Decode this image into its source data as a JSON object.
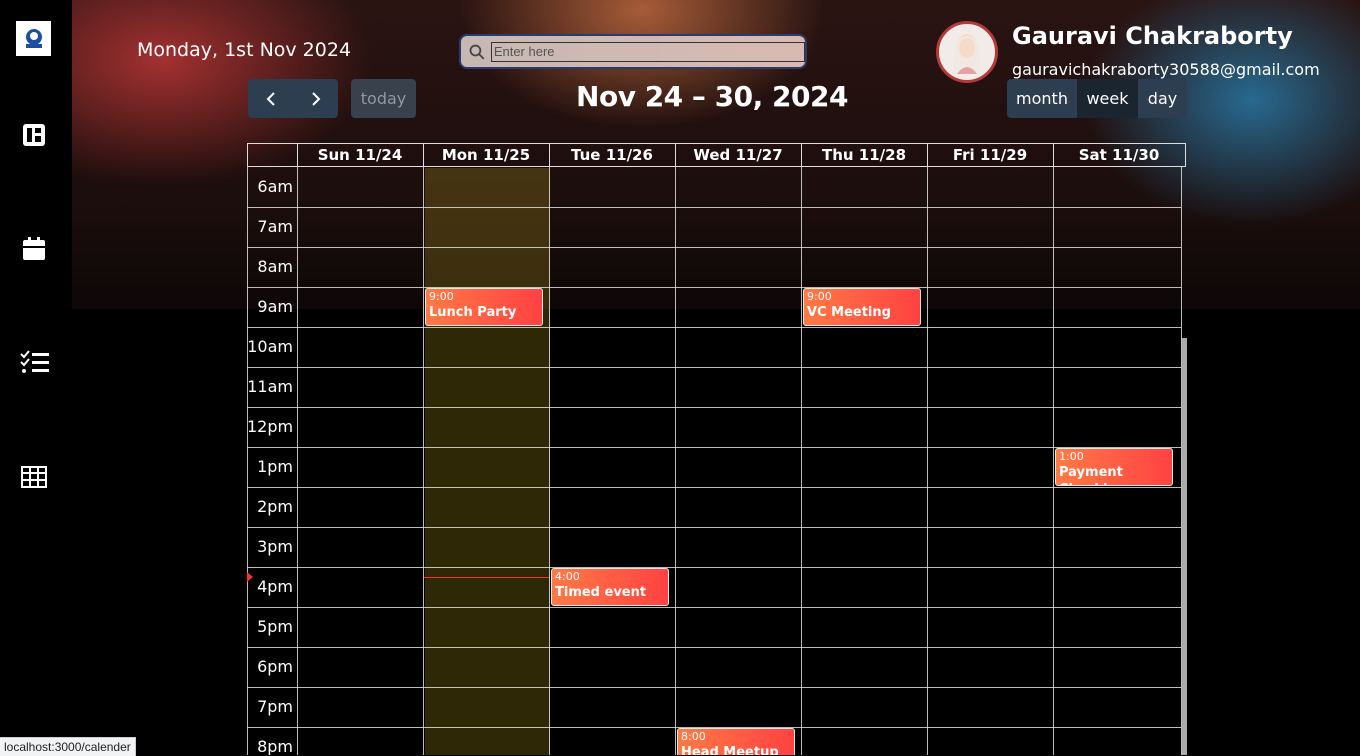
{
  "header": {
    "current_date": "Monday, 1st Nov 2024",
    "search_placeholder": "Enter here",
    "user_name": "Gauravi Chakraborty",
    "user_email": "gauravichakraborty30588@gmail.com"
  },
  "toolbar": {
    "today_label": "today",
    "title": "Nov 24 – 30, 2024",
    "views": [
      "month",
      "week",
      "day"
    ],
    "active_view": "week"
  },
  "calendar": {
    "days": [
      "Sun 11/24",
      "Mon 11/25",
      "Tue 11/26",
      "Wed 11/27",
      "Thu 11/28",
      "Fri 11/29",
      "Sat 11/30"
    ],
    "times": [
      "6am",
      "7am",
      "8am",
      "9am",
      "10am",
      "11am",
      "12pm",
      "1pm",
      "2pm",
      "3pm",
      "4pm",
      "5pm",
      "6pm",
      "7pm",
      "8pm"
    ],
    "events": [
      {
        "time": "9:00",
        "title": "Lunch Party",
        "day": 1
      },
      {
        "time": "9:00",
        "title": "VC Meeting",
        "day": 4
      },
      {
        "time": "1:00",
        "title": "Payment Checking",
        "day": 6
      },
      {
        "time": "4:00",
        "title": "Timed event",
        "day": 2
      },
      {
        "time": "8:00",
        "title": "Head Meetup",
        "day": 3
      }
    ]
  },
  "status_bar": {
    "url": "localhost:3000/calender"
  }
}
